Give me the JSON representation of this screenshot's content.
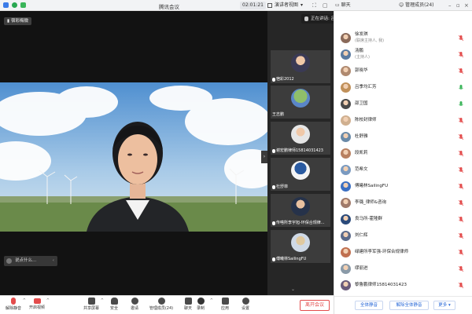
{
  "window": {
    "title": "腾讯会议",
    "timer": "02:01:21",
    "view_label": "演讲者视图",
    "chat_label": "聊天",
    "members_label": "管理成员(24)"
  },
  "stage": {
    "speaker_tag": "宿彩梅微",
    "talk_prompt": "说点什么...",
    "speaking_banner": "正在讲话: 吕季均汇芳; 邵卫国;"
  },
  "thumbnails": [
    {
      "name": "宿彩2012"
    },
    {
      "name": "王志鹏"
    },
    {
      "name": "谢宏鹏律师15814031423"
    },
    {
      "name": "杜舒菲"
    },
    {
      "name": "传嗒所李宇旭-环保合规律..."
    },
    {
      "name": "傅曦林SailingFU"
    }
  ],
  "members": [
    {
      "name": "徐发琪",
      "sub": "(联席主持人, 我)"
    },
    {
      "name": "汤鹏",
      "sub": "(主持人)"
    },
    {
      "name": "郭晓华",
      "sub": ""
    },
    {
      "name": "吕季均汇芳",
      "sub": ""
    },
    {
      "name": "邵卫国",
      "sub": ""
    },
    {
      "name": "陈校封律师",
      "sub": ""
    },
    {
      "name": "杜舒雅",
      "sub": ""
    },
    {
      "name": "段凯莉",
      "sub": ""
    },
    {
      "name": "范希文",
      "sub": ""
    },
    {
      "name": "傅曦林SailingFU",
      "sub": ""
    },
    {
      "name": "李璐_律师&咨询",
      "sub": ""
    },
    {
      "name": "良马所-霍隆群",
      "sub": ""
    },
    {
      "name": "刘仁辉",
      "sub": ""
    },
    {
      "name": "绿建所李军强-环保合规律师",
      "sub": ""
    },
    {
      "name": "缪丽进",
      "sub": ""
    },
    {
      "name": "黎鲁鹏律师15814031423",
      "sub": ""
    }
  ],
  "panel_buttons": {
    "mute_all": "全体静音",
    "unmute_all": "解除全体静音",
    "more": "更多"
  },
  "toolbar": {
    "unmute": "解除静音",
    "video": "开启视频",
    "share": "共享屏幕",
    "security": "安全",
    "invite": "邀请",
    "manage": "管理成员(24)",
    "chat": "聊天",
    "record": "录制",
    "apps": "应用",
    "settings": "设置",
    "leave": "离开会议"
  },
  "colors": {
    "accent": "#2a6ad8",
    "danger": "#e34c4c",
    "mic_on": "#3bb55a"
  }
}
